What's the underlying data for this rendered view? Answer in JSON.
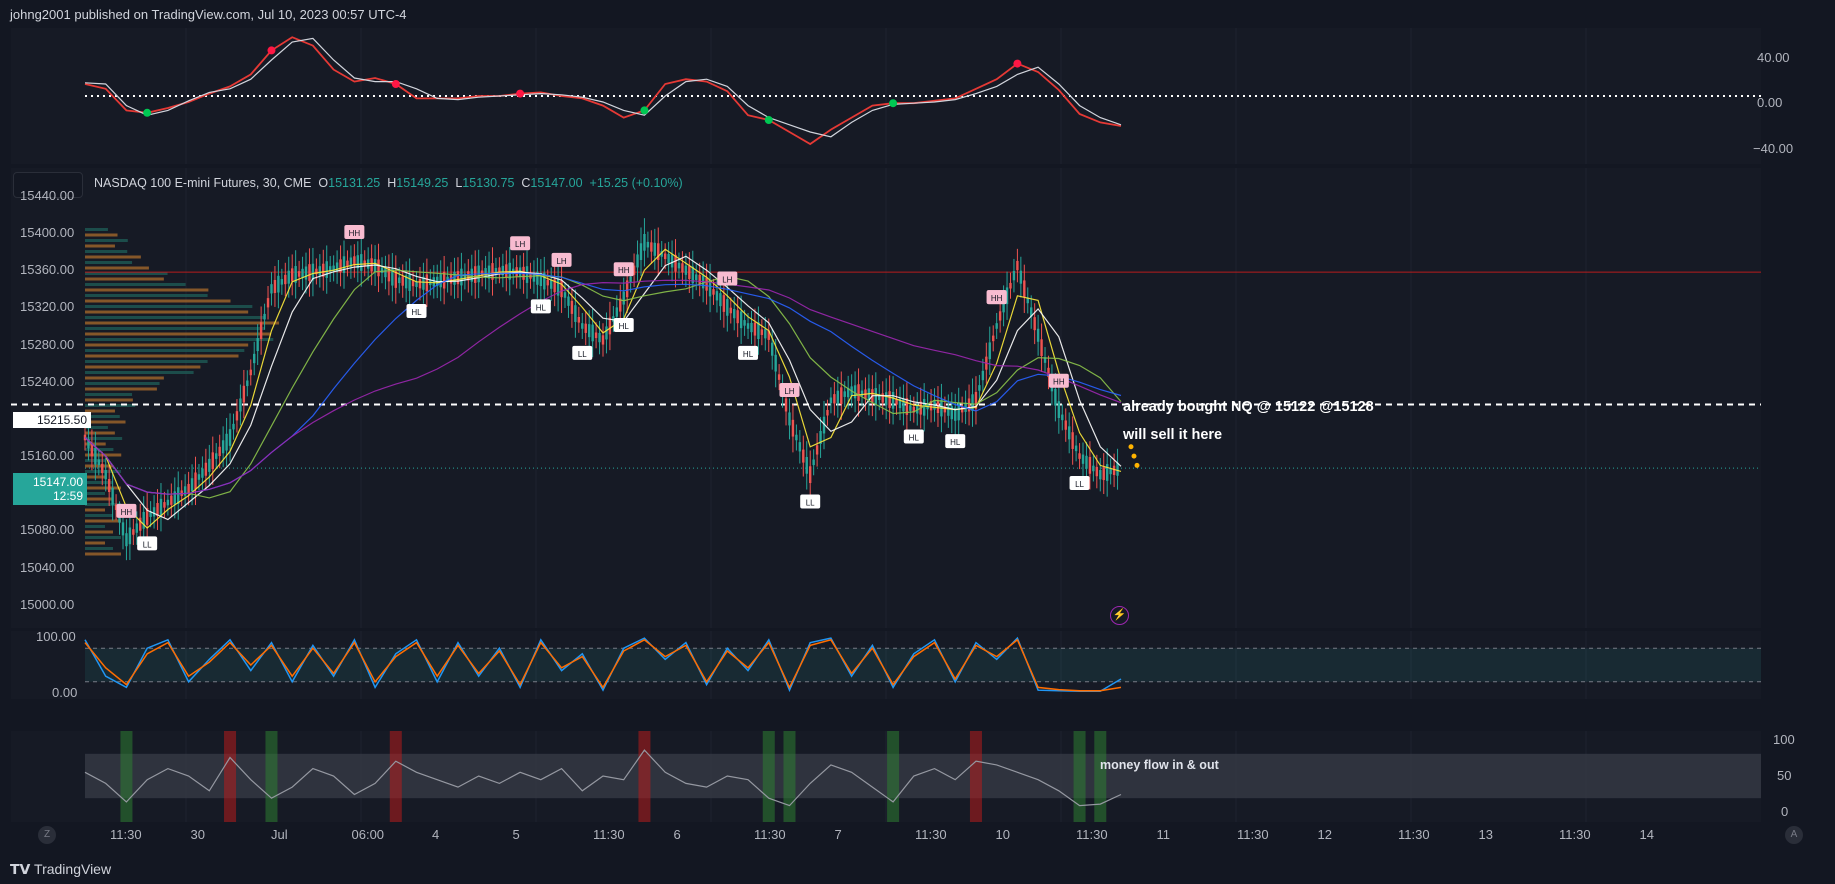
{
  "header": {
    "title": "johng2001 published on TradingView.com, Jul 10, 2023 00:57 UTC-4"
  },
  "symbol": {
    "name": "NASDAQ 100 E-mini Futures, 30, CME",
    "o_label": "O",
    "o": "15131.25",
    "h_label": "H",
    "h": "15149.25",
    "l_label": "L",
    "l": "15130.75",
    "c_label": "C",
    "c": "15147.00",
    "change": "+15.25 (+0.10%)"
  },
  "price_tags": {
    "line": "15215.50",
    "last": "15147.00",
    "countdown": "12:59"
  },
  "annotations": {
    "line1": "already bought NQ @ 15122 @15128",
    "line2": "will sell it here",
    "money_flow": "money flow in & out"
  },
  "footer": {
    "brand": "TradingView",
    "z_button": "Z",
    "a_button": "A"
  },
  "colors": {
    "background": "#131722",
    "up": "#26a69a",
    "down": "#ef5350",
    "accent": "#2962ff"
  },
  "chart_data": [
    {
      "type": "line",
      "pane": "oscillator",
      "y_ticks": [
        "40.00",
        "0.00",
        "−40.00"
      ],
      "ylim": [
        -50,
        50
      ],
      "x": [
        0,
        2,
        4,
        6,
        8,
        10,
        12,
        14,
        16,
        18,
        20,
        22,
        24,
        26,
        28,
        30,
        32,
        34,
        36,
        38,
        40,
        42,
        44,
        46,
        48,
        50,
        52,
        54,
        56,
        58,
        60,
        62,
        64,
        66,
        68,
        70,
        72,
        74,
        76,
        78,
        80,
        82,
        84,
        86,
        88,
        90,
        92,
        94,
        96,
        98,
        100
      ],
      "series": [
        {
          "values": [
            10,
            6,
            -12,
            -14,
            -10,
            -5,
            2,
            8,
            18,
            38,
            49,
            42,
            22,
            12,
            15,
            10,
            -2,
            -2,
            -2,
            0,
            0,
            2,
            3,
            0,
            -2,
            -8,
            -18,
            -12,
            10,
            14,
            12,
            4,
            -16,
            -20,
            -30,
            -40,
            -28,
            -18,
            -8,
            -6,
            -6,
            -4,
            -2,
            6,
            14,
            27,
            20,
            5,
            -15,
            -22,
            -25
          ]
        },
        {
          "values": [
            11,
            10,
            -8,
            -16,
            -12,
            -4,
            3,
            6,
            14,
            30,
            45,
            48,
            30,
            15,
            12,
            12,
            6,
            -2,
            -3,
            -1,
            0,
            1,
            2,
            1,
            -1,
            -5,
            -12,
            -16,
            0,
            12,
            14,
            8,
            -8,
            -18,
            -24,
            -30,
            -34,
            -22,
            -12,
            -7,
            -6,
            -5,
            -3,
            2,
            8,
            18,
            24,
            10,
            -8,
            -18,
            -24
          ]
        }
      ]
    },
    {
      "type": "line",
      "pane": "price",
      "y_ticks": [
        "15440.00",
        "15400.00",
        "15360.00",
        "15320.00",
        "15280.00",
        "15240.00",
        "15200.00",
        "15160.00",
        "15120.00",
        "15080.00",
        "15040.00",
        "15000.00"
      ],
      "ylim": [
        14975,
        15470
      ],
      "x_ticks": [
        "11:30",
        "30",
        "Jul",
        "06:00",
        "4",
        "5",
        "11:30",
        "6",
        "11:30",
        "7",
        "11:30",
        "10",
        "11:30",
        "11",
        "11:30",
        "12",
        "11:30",
        "13",
        "11:30",
        "14"
      ],
      "x": [
        0,
        2,
        4,
        6,
        8,
        10,
        12,
        14,
        16,
        18,
        20,
        22,
        24,
        26,
        28,
        30,
        32,
        34,
        36,
        38,
        40,
        42,
        44,
        46,
        48,
        50,
        52,
        54,
        56,
        58,
        60,
        62,
        64,
        66,
        68,
        70,
        72,
        74,
        76,
        78,
        80,
        82,
        84,
        86,
        88,
        90,
        92,
        94,
        96,
        98,
        100
      ],
      "series": [
        {
          "values": [
            15180,
            15140,
            15070,
            15095,
            15110,
            15125,
            15150,
            15180,
            15250,
            15340,
            15355,
            15358,
            15362,
            15370,
            15365,
            15350,
            15345,
            15348,
            15352,
            15356,
            15360,
            15358,
            15350,
            15340,
            15300,
            15285,
            15330,
            15390,
            15375,
            15360,
            15345,
            15320,
            15300,
            15290,
            15200,
            15140,
            15220,
            15230,
            15225,
            15220,
            15210,
            15215,
            15205,
            15220,
            15300,
            15365,
            15290,
            15210,
            15160,
            15140,
            15147
          ]
        }
      ],
      "levels": [
        15358,
        15215.5,
        15147
      ],
      "swing_labels": [
        "HH",
        "LL",
        "HH",
        "HL",
        "LH",
        "HL",
        "LH",
        "LL",
        "HH",
        "HL",
        "LH",
        "HL",
        "LH",
        "LL",
        "HH",
        "HL",
        "HL",
        "HH",
        "LL",
        "HH"
      ]
    },
    {
      "type": "line",
      "pane": "stochastic",
      "y_ticks": [
        "100.00",
        "0.00"
      ],
      "ylim": [
        0,
        100
      ],
      "x": [
        0,
        2,
        4,
        6,
        8,
        10,
        12,
        14,
        16,
        18,
        20,
        22,
        24,
        26,
        28,
        30,
        32,
        34,
        36,
        38,
        40,
        42,
        44,
        46,
        48,
        50,
        52,
        54,
        56,
        58,
        60,
        62,
        64,
        66,
        68,
        70,
        72,
        74,
        76,
        78,
        80,
        82,
        84,
        86,
        88,
        90,
        92,
        94,
        96,
        98,
        100
      ],
      "series": [
        {
          "values": [
            95,
            30,
            10,
            80,
            95,
            20,
            60,
            95,
            40,
            90,
            20,
            85,
            30,
            95,
            10,
            70,
            95,
            20,
            90,
            30,
            80,
            10,
            95,
            40,
            70,
            5,
            80,
            98,
            60,
            90,
            15,
            80,
            40,
            95,
            5,
            90,
            98,
            30,
            85,
            10,
            70,
            95,
            20,
            90,
            60,
            98,
            5,
            4,
            3,
            3,
            25
          ]
        },
        {
          "values": [
            90,
            45,
            15,
            70,
            90,
            30,
            55,
            90,
            50,
            85,
            30,
            80,
            35,
            90,
            20,
            65,
            90,
            30,
            85,
            35,
            75,
            15,
            90,
            45,
            65,
            10,
            75,
            95,
            65,
            85,
            20,
            75,
            45,
            90,
            10,
            85,
            95,
            35,
            80,
            15,
            65,
            90,
            25,
            85,
            65,
            95,
            10,
            6,
            4,
            4,
            10
          ]
        }
      ]
    },
    {
      "type": "line",
      "pane": "money_flow",
      "y_ticks": [
        "100",
        "50",
        "0"
      ],
      "ylim": [
        0,
        100
      ],
      "x": [
        0,
        2,
        4,
        6,
        8,
        10,
        12,
        14,
        16,
        18,
        20,
        22,
        24,
        26,
        28,
        30,
        32,
        34,
        36,
        38,
        40,
        42,
        44,
        46,
        48,
        50,
        52,
        54,
        56,
        58,
        60,
        62,
        64,
        66,
        68,
        70,
        72,
        74,
        76,
        78,
        80,
        82,
        84,
        86,
        88,
        90,
        92,
        94,
        96,
        98,
        100
      ],
      "series": [
        {
          "values": [
            55,
            40,
            15,
            45,
            60,
            50,
            30,
            75,
            45,
            20,
            35,
            60,
            50,
            25,
            40,
            70,
            55,
            45,
            35,
            50,
            40,
            55,
            45,
            60,
            30,
            50,
            45,
            85,
            55,
            40,
            35,
            50,
            45,
            20,
            10,
            40,
            65,
            55,
            35,
            15,
            50,
            60,
            45,
            70,
            65,
            55,
            45,
            30,
            10,
            12,
            25
          ]
        }
      ]
    }
  ]
}
